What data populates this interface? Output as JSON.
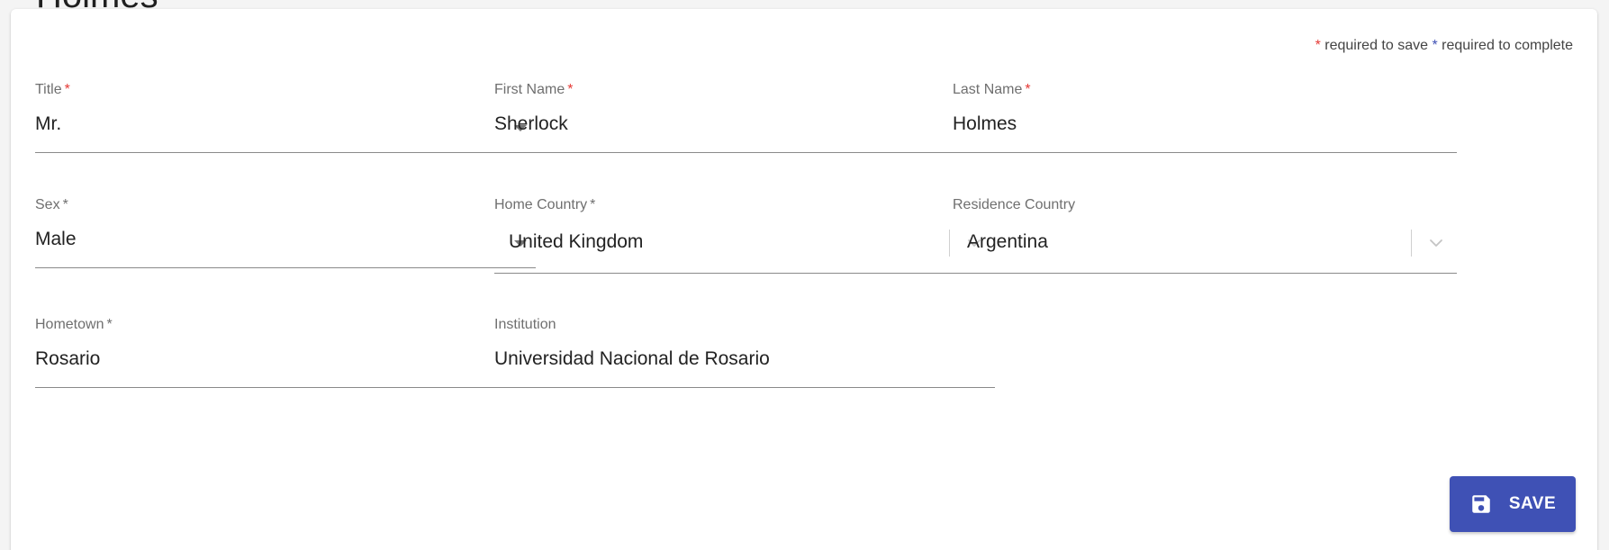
{
  "page": {
    "heading_fragment": "Holmes"
  },
  "legend": {
    "star": "*",
    "save_text": "required to save",
    "complete_text": "required to complete"
  },
  "form": {
    "title": {
      "label": "Title",
      "required": "*",
      "value": "Mr."
    },
    "first_name": {
      "label": "First Name",
      "required": "*",
      "value": "Sherlock"
    },
    "last_name": {
      "label": "Last Name",
      "required": "*",
      "value": "Holmes"
    },
    "sex": {
      "label": "Sex",
      "required": "*",
      "value": "Male"
    },
    "home_country": {
      "label": "Home Country",
      "required": "*",
      "value": "United Kingdom"
    },
    "residence_country": {
      "label": "Residence Country",
      "value": "Argentina"
    },
    "hometown": {
      "label": "Hometown",
      "required": "*",
      "value": "Rosario"
    },
    "institution": {
      "label": "Institution",
      "value": "Universidad Nacional de Rosario"
    }
  },
  "actions": {
    "save_label": "SAVE"
  },
  "colors": {
    "primary": "#3f51b5",
    "required_save": "#e53935",
    "required_complete": "#3f51b5"
  },
  "icons": {
    "save": "save-icon",
    "dropdown": "caret-down-icon",
    "combo": "chevron-down-icon"
  }
}
